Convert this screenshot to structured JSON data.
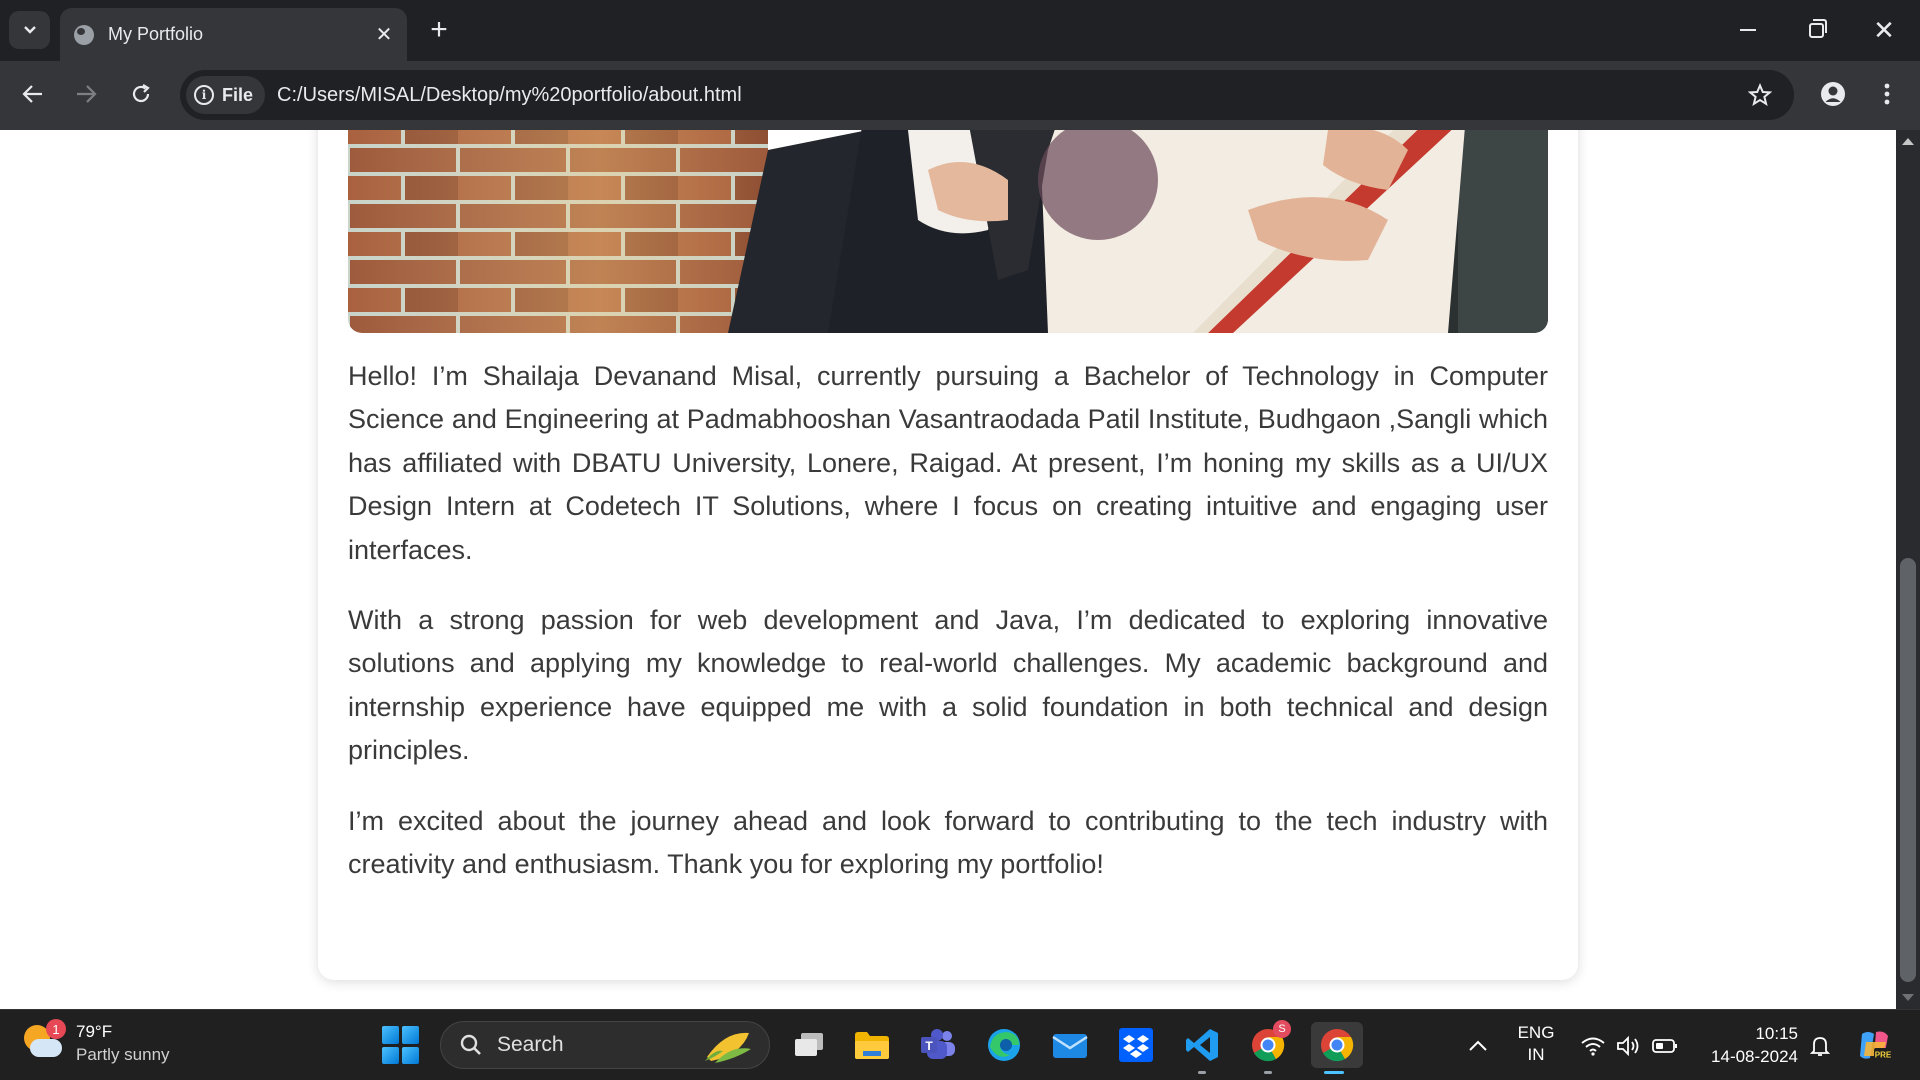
{
  "browser": {
    "tab_title": "My Portfolio",
    "url_scheme_label": "File",
    "url": "C:/Users/MISAL/Desktop/my%20portfolio/about.html"
  },
  "page": {
    "paragraphs": [
      "Hello! I’m Shailaja Devanand Misal, currently pursuing a Bachelor of Technology in Computer Science and Engineering at Padmabhooshan Vasantraodada Patil Institute, Budhgaon ,Sangli which has affiliated with DBATU University, Lonere, Raigad. At present, I’m honing my skills as a UI/UX Design Intern at Codetech IT Solutions, where I focus on creating intuitive and engaging user interfaces.",
      "With a strong passion for web development and Java, I’m dedicated to exploring innovative solutions and applying my knowledge to real-world challenges. My academic background and internship experience have equipped me with a solid foundation in both technical and design principles.",
      "I’m excited about the journey ahead and look forward to contributing to the tech industry with creativity and enthusiasm. Thank you for exploring my portfolio!"
    ]
  },
  "taskbar": {
    "weather_temp": "79°F",
    "weather_condition": "Partly sunny",
    "weather_badge": "1",
    "search_placeholder": "Search",
    "lang_top": "ENG",
    "lang_bottom": "IN",
    "time": "10:15",
    "date": "14-08-2024",
    "chrome_profile_badge": "S",
    "apps": [
      "task-view",
      "file-explorer",
      "teams",
      "edge",
      "mail",
      "dropbox",
      "vscode",
      "chrome-profile",
      "chrome"
    ]
  },
  "colors": {
    "chrome_dark": "#202124",
    "toolbar": "#35363a",
    "page_bg": "#ffffff",
    "body_text": "#3a3a3a",
    "taskbar": "#202020",
    "accent": "#4cc2ff"
  }
}
